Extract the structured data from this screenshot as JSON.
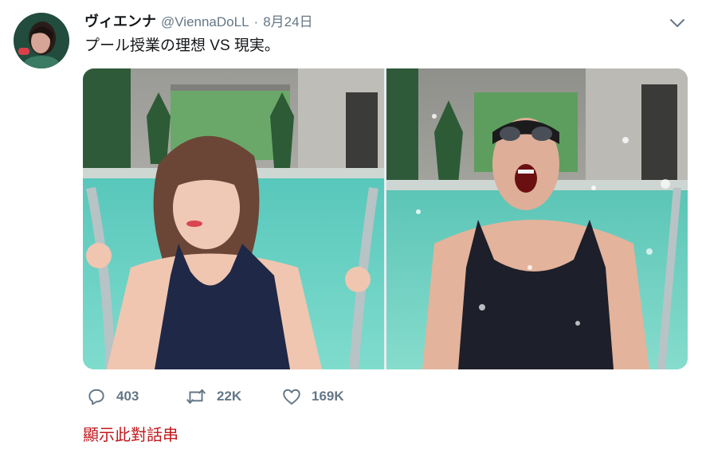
{
  "tweet": {
    "display_name": "ヴィエンナ",
    "handle": "@ViennaDoLL",
    "separator": "·",
    "date": "8月24日",
    "text": "プール授業の理想 VS 現実。"
  },
  "media": {
    "photos": [
      {
        "name": "ideal-photo"
      },
      {
        "name": "reality-photo"
      }
    ]
  },
  "actions": {
    "reply_count": "403",
    "retweet_count": "22K",
    "like_count": "169K"
  },
  "thread_link": "顯示此對話串",
  "colors": {
    "text": "#14171a",
    "secondary": "#657786",
    "link": "#c0181d",
    "background": "#ffffff"
  },
  "icons": {
    "reply": "reply-icon",
    "retweet": "retweet-icon",
    "like": "heart-icon",
    "menu": "chevron-down-icon"
  }
}
